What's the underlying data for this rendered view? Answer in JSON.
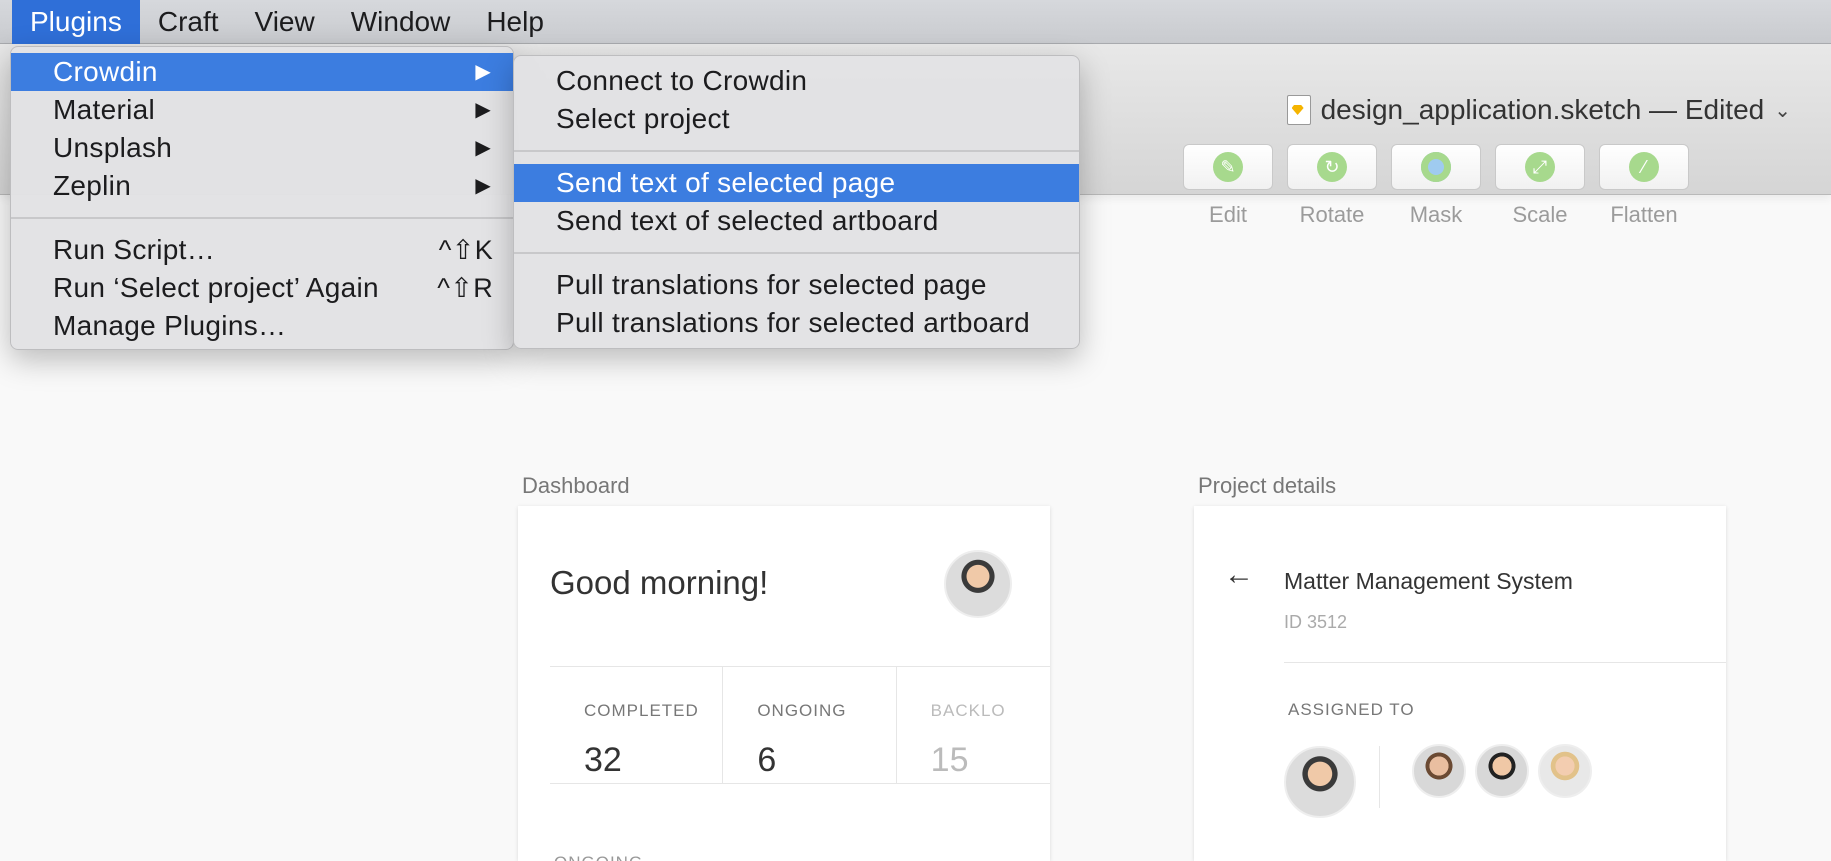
{
  "menubar": {
    "items": [
      "Plugins",
      "Craft",
      "View",
      "Window",
      "Help"
    ]
  },
  "window": {
    "title": "design_application.sketch — Edited"
  },
  "toolbar": {
    "tools": [
      {
        "label": "Edit",
        "icon": "edit-icon"
      },
      {
        "label": "Rotate",
        "icon": "rotate-icon"
      },
      {
        "label": "Mask",
        "icon": "mask-icon"
      },
      {
        "label": "Scale",
        "icon": "scale-icon"
      },
      {
        "label": "Flatten",
        "icon": "flatten-icon"
      }
    ]
  },
  "plugins_menu": {
    "submenus": [
      "Crowdin",
      "Material",
      "Unsplash",
      "Zeplin"
    ],
    "actions": [
      {
        "label": "Run Script…",
        "shortcut": "^⇧K"
      },
      {
        "label": "Run ‘Select project’ Again",
        "shortcut": "^⇧R"
      },
      {
        "label": "Manage Plugins…",
        "shortcut": ""
      }
    ],
    "arrow": "▶"
  },
  "crowdin_submenu": {
    "group1": [
      "Connect to Crowdin",
      "Select project"
    ],
    "group2": [
      "Send text of selected page",
      "Send text of selected artboard"
    ],
    "group3": [
      "Pull translations for selected page",
      "Pull translations for selected artboard"
    ]
  },
  "dashboard": {
    "artboard_label": "Dashboard",
    "greeting": "Good morning!",
    "stats": [
      {
        "label": "COMPLETED",
        "value": "32"
      },
      {
        "label": "ONGOING",
        "value": "6"
      },
      {
        "label": "BACKLO",
        "value": "15"
      }
    ],
    "section_label": "ONGOING"
  },
  "project": {
    "artboard_label": "Project details",
    "back_arrow": "←",
    "name": "Matter Management System",
    "id": "ID 3512",
    "assigned_label": "ASSIGNED TO"
  },
  "colors": {
    "menu_highlight": "#3c7de0",
    "menubar_active": "#2f6fd8",
    "tool_icon": "#a7d98d"
  }
}
